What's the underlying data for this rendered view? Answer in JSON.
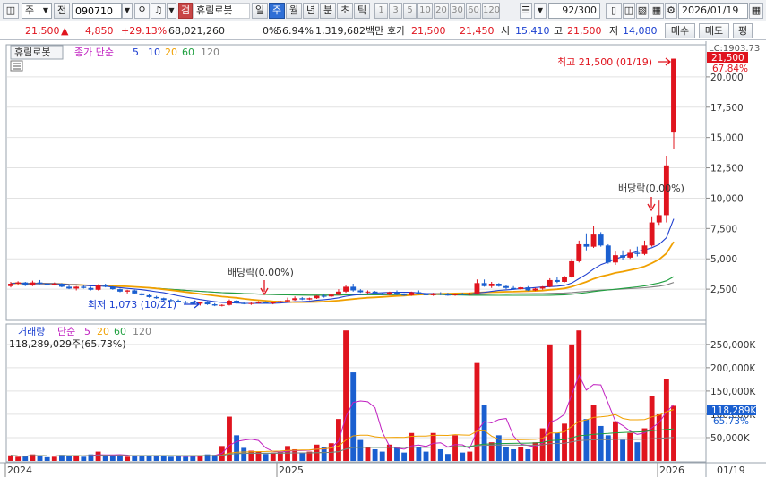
{
  "toolbar": {
    "market": "주",
    "prev_label": "전",
    "code": "090710",
    "badge": "검",
    "name": "휴림로봇",
    "periods": [
      "일",
      "주",
      "월",
      "년",
      "분",
      "초",
      "틱"
    ],
    "active_period": "주",
    "intervals": [
      "1",
      "3",
      "5",
      "10",
      "20",
      "30",
      "60",
      "120"
    ],
    "count": "92/300",
    "date": "2026/01/19"
  },
  "quote": {
    "price": "21,500",
    "arrow": "▲",
    "change": "4,850",
    "change_pct": "+29.13%",
    "volume": "68,021,260",
    "pct_field": "0%",
    "ratio": "56.94%",
    "amount": "1,319,682백만",
    "ask_label": "호가",
    "ask": "21,500",
    "bid": "21,450",
    "open_label": "시",
    "open": "15,410",
    "high_label": "고",
    "high": "21,500",
    "low_label": "저",
    "low": "14,080",
    "buy_label": "매수",
    "sell_label": "매도",
    "eval_label": "평"
  },
  "price_panel": {
    "stock_tag": "휴림로봇",
    "legend_prefix": "종가 단순",
    "ma_periods": [
      "5",
      "10",
      "20",
      "60",
      "120"
    ],
    "ma_colors": [
      "#2040d0",
      "#2040d0",
      "#f0a000",
      "#20a040",
      "#808080"
    ],
    "y_ticks": [
      "20,000",
      "17,500",
      "15,000",
      "12,500",
      "10,000",
      "7,500",
      "5,000",
      "2,500"
    ],
    "axis_top_label": "LC:1903.73",
    "price_tag": "21,500",
    "pct_tag": "67.84%",
    "high_annotation": "최고 21,500 (01/19)",
    "low_annotation": "최저 1,073 (10/21)",
    "dividend_label_1": "배당락(0.00%)",
    "dividend_label_2": "배당락(0.00%)"
  },
  "volume_panel": {
    "title": "거래량",
    "legend_prefix": "단순",
    "ma_periods": [
      "5",
      "20",
      "60",
      "120"
    ],
    "ma_colors": [
      "#c020c0",
      "#f0a000",
      "#20a040",
      "#808080"
    ],
    "volume_text": "118,289,029주(65.73%)",
    "y_ticks": [
      "250,000K",
      "200,000K",
      "150,000K",
      "100,000K",
      "50,000K"
    ],
    "vol_tag": "118,289K",
    "vol_pct_tag": "65.73%"
  },
  "x_axis": {
    "labels": [
      "2024",
      "2025",
      "2026"
    ],
    "right_label": "01/19"
  },
  "colors": {
    "up": "#e0141e",
    "down": "#1a5fd0",
    "grid": "#e2e2e2"
  },
  "chart_data": {
    "type": "candlestick",
    "x_range": [
      "2024/01",
      "2026/01/19"
    ],
    "price_ylim": [
      0,
      22500
    ],
    "volume_ylim": [
      0,
      290000
    ],
    "candles": [
      [
        2750,
        3100,
        2650,
        2950,
        12000
      ],
      [
        2950,
        3150,
        2800,
        3050,
        9000
      ],
      [
        3050,
        3100,
        2750,
        2800,
        10000
      ],
      [
        2800,
        3200,
        2750,
        3050,
        14000
      ],
      [
        3050,
        3250,
        2900,
        2950,
        12000
      ],
      [
        2950,
        3000,
        2800,
        2900,
        8000
      ],
      [
        2900,
        3050,
        2800,
        2950,
        9000
      ],
      [
        2950,
        3000,
        2650,
        2700,
        13000
      ],
      [
        2700,
        2900,
        2500,
        2550,
        11000
      ],
      [
        2550,
        2750,
        2400,
        2700,
        12000
      ],
      [
        2700,
        2850,
        2550,
        2600,
        9000
      ],
      [
        2600,
        2700,
        2400,
        2450,
        14000
      ],
      [
        2450,
        2900,
        2400,
        2800,
        20000
      ],
      [
        2800,
        2950,
        2650,
        2700,
        10000
      ],
      [
        2700,
        2750,
        2450,
        2500,
        11000
      ],
      [
        2500,
        2550,
        2250,
        2300,
        12000
      ],
      [
        2300,
        2450,
        2150,
        2400,
        9000
      ],
      [
        2400,
        2450,
        2100,
        2150,
        10000
      ],
      [
        2150,
        2250,
        1950,
        2000,
        11000
      ],
      [
        2000,
        2100,
        1800,
        1850,
        12000
      ],
      [
        1850,
        1950,
        1700,
        1750,
        10000
      ],
      [
        1750,
        1800,
        1550,
        1600,
        11000
      ],
      [
        1600,
        1700,
        1450,
        1550,
        9000
      ],
      [
        1550,
        1650,
        1400,
        1450,
        10000
      ],
      [
        1450,
        1550,
        1300,
        1400,
        9000
      ],
      [
        1400,
        1500,
        1250,
        1300,
        11000
      ],
      [
        1300,
        1450,
        1150,
        1400,
        12000
      ],
      [
        1400,
        1500,
        1200,
        1250,
        14000
      ],
      [
        1250,
        1350,
        1100,
        1150,
        13000
      ],
      [
        1150,
        1250,
        1073,
        1200,
        32000
      ],
      [
        1200,
        1650,
        1150,
        1550,
        95000
      ],
      [
        1550,
        1600,
        1300,
        1350,
        55000
      ],
      [
        1350,
        1450,
        1250,
        1300,
        28000
      ],
      [
        1300,
        1400,
        1200,
        1350,
        22000
      ],
      [
        1350,
        1500,
        1300,
        1450,
        20000
      ],
      [
        1450,
        1500,
        1300,
        1350,
        15000
      ],
      [
        1350,
        1450,
        1250,
        1400,
        18000
      ],
      [
        1400,
        1550,
        1350,
        1500,
        20000
      ],
      [
        1500,
        1800,
        1450,
        1600,
        32000
      ],
      [
        1600,
        1900,
        1550,
        1750,
        25000
      ],
      [
        1750,
        1850,
        1600,
        1650,
        18000
      ],
      [
        1650,
        1800,
        1600,
        1750,
        20000
      ],
      [
        1750,
        2000,
        1700,
        1950,
        35000
      ],
      [
        1950,
        2100,
        1800,
        1900,
        30000
      ],
      [
        1900,
        2100,
        1850,
        2050,
        38000
      ],
      [
        2050,
        2500,
        2000,
        2300,
        90000
      ],
      [
        2300,
        2800,
        2200,
        2700,
        280000
      ],
      [
        2700,
        2950,
        2300,
        2400,
        190000
      ],
      [
        2400,
        2500,
        2200,
        2250,
        45000
      ],
      [
        2250,
        2400,
        2150,
        2300,
        30000
      ],
      [
        2300,
        2350,
        2100,
        2150,
        25000
      ],
      [
        2150,
        2250,
        2000,
        2050,
        20000
      ],
      [
        2050,
        2300,
        2000,
        2250,
        35000
      ],
      [
        2250,
        2400,
        2000,
        2050,
        28000
      ],
      [
        2050,
        2150,
        1950,
        2000,
        18000
      ],
      [
        2000,
        2300,
        1950,
        2250,
        60000
      ],
      [
        2250,
        2400,
        2050,
        2100,
        30000
      ],
      [
        2100,
        2150,
        1950,
        2000,
        20000
      ],
      [
        2000,
        2200,
        1950,
        2150,
        60000
      ],
      [
        2150,
        2250,
        2000,
        2050,
        25000
      ],
      [
        2050,
        2200,
        1950,
        2000,
        15000
      ],
      [
        2000,
        2150,
        1950,
        2100,
        55000
      ],
      [
        2100,
        2200,
        2000,
        2050,
        18000
      ],
      [
        2050,
        2200,
        2000,
        2150,
        20000
      ],
      [
        2150,
        3300,
        2100,
        3000,
        210000
      ],
      [
        3000,
        3300,
        2700,
        2750,
        120000
      ],
      [
        2750,
        3100,
        2600,
        2950,
        40000
      ],
      [
        2950,
        3000,
        2700,
        2750,
        55000
      ],
      [
        2750,
        2850,
        2500,
        2600,
        30000
      ],
      [
        2600,
        2750,
        2450,
        2500,
        25000
      ],
      [
        2500,
        2700,
        2450,
        2650,
        30000
      ],
      [
        2650,
        2750,
        2350,
        2400,
        25000
      ],
      [
        2400,
        2600,
        2350,
        2550,
        40000
      ],
      [
        2550,
        2750,
        2450,
        2700,
        70000
      ],
      [
        2700,
        3400,
        2650,
        3250,
        250000
      ],
      [
        3250,
        3500,
        3000,
        3100,
        60000
      ],
      [
        3100,
        3600,
        3050,
        3500,
        80000
      ],
      [
        3500,
        5000,
        3450,
        4800,
        250000
      ],
      [
        4800,
        6500,
        4700,
        6200,
        280000
      ],
      [
        6200,
        7100,
        5700,
        6000,
        90000
      ],
      [
        6000,
        7700,
        5900,
        7000,
        120000
      ],
      [
        7000,
        7200,
        6000,
        6100,
        75000
      ],
      [
        6100,
        6200,
        4600,
        4700,
        55000
      ],
      [
        4700,
        5600,
        4500,
        5300,
        85000
      ],
      [
        5300,
        5700,
        4900,
        5100,
        45000
      ],
      [
        5100,
        5800,
        5000,
        5500,
        60000
      ],
      [
        5500,
        6000,
        5200,
        5400,
        40000
      ],
      [
        5400,
        6500,
        5300,
        6100,
        70000
      ],
      [
        6100,
        8500,
        6000,
        8000,
        140000
      ],
      [
        8000,
        9800,
        7800,
        8600,
        100000
      ],
      [
        8600,
        13500,
        8000,
        12700,
        175000
      ],
      [
        15410,
        21500,
        14080,
        21500,
        118289
      ]
    ]
  }
}
